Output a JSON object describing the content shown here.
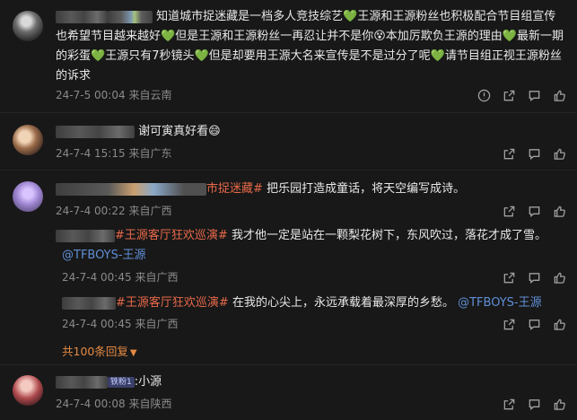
{
  "comments": [
    {
      "text_parts": [
        "知道城市捉迷藏是一档多人竞技综艺",
        "💚",
        "王源和王源粉丝也积极配合节目组宣传 也希望节目越来越好",
        "💚",
        "但是王源和王源粉丝一再忍让并不是你",
        "本加厉欺负王源的理由",
        "💚",
        "最新一期的彩蛋",
        "💚",
        "王源只有7秒镜头",
        "💚",
        "但是却要用王源大名来宣传是不是过分了呢",
        "💚",
        "请节目组正视王源粉丝的诉求"
      ],
      "emoji_inline": "😵",
      "date": "24-7-5 00:04",
      "location": "来自云南"
    },
    {
      "text": "谢可寅真好看",
      "emoji": "😄",
      "date": "24-7-4 15:15",
      "location": "来自广东"
    },
    {
      "tag": "市捉迷藏",
      "tag_suffix": "#",
      "text": "把乐园打造成童话，将天空编写成诗。",
      "date": "24-7-4 00:22",
      "location": "来自广西",
      "replies": [
        {
          "tag": "#王源客厅狂欢巡演#",
          "text": "我才他一定是站在一颗梨花树下，东风吹过，落花才成了雪。",
          "mention": "@TFBOYS-王源",
          "date": "24-7-4 00:45",
          "location": "来自广西"
        },
        {
          "tag": "#王源客厅狂欢巡演#",
          "text": "在我的心尖上，永远承载着最深厚的乡愁。",
          "mention": "@TFBOYS-王源",
          "date": "24-7-4 00:45",
          "location": "来自广西"
        }
      ],
      "more_replies": "共100条回复"
    },
    {
      "badge": "铁粉1",
      "text": ":小源",
      "date": "24-7-4 00:08",
      "location": "来自陕西"
    }
  ]
}
